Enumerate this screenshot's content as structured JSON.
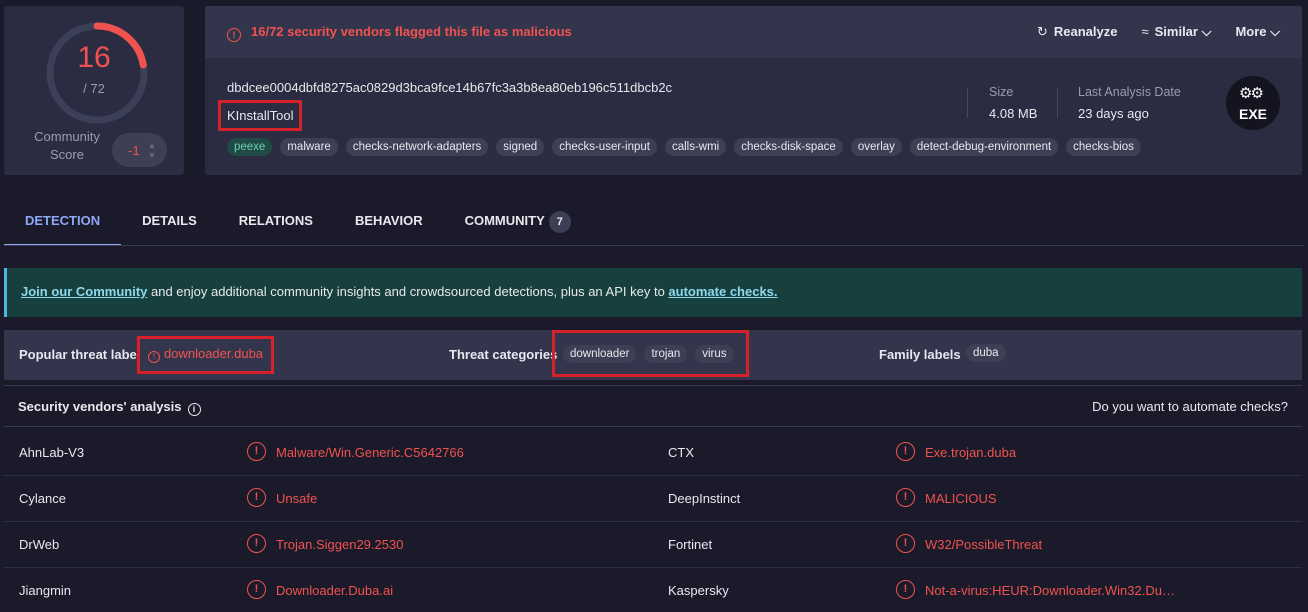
{
  "score": {
    "detections": "16",
    "total": "/ 72",
    "detection_ratio": 0.222,
    "community_label_1": "Community",
    "community_label_2": "Score",
    "community_value": "-1"
  },
  "header": {
    "flag_message": "16/72 security vendors flagged this file as malicious",
    "reanalyze": "Reanalyze",
    "similar": "Similar",
    "more": "More"
  },
  "file": {
    "hash": "dbdcee0004dbfd8275ac0829d3bca9fce14b67fc3a3b8ea80eb196c511dbcb2c",
    "name": "KInstallTool",
    "tags": [
      "peexe",
      "malware",
      "checks-network-adapters",
      "signed",
      "checks-user-input",
      "calls-wmi",
      "checks-disk-space",
      "overlay",
      "detect-debug-environment",
      "checks-bios"
    ],
    "size_label": "Size",
    "size_value": "4.08 MB",
    "date_label": "Last Analysis Date",
    "date_value": "23 days ago",
    "type_badge": "EXE"
  },
  "tabs": [
    {
      "label": "DETECTION"
    },
    {
      "label": "DETAILS"
    },
    {
      "label": "RELATIONS"
    },
    {
      "label": "BEHAVIOR"
    },
    {
      "label": "COMMUNITY",
      "count": "7"
    }
  ],
  "banner": {
    "link1": "Join our Community",
    "text": " and enjoy additional community insights and crowdsourced detections, plus an API key to ",
    "link2": "automate checks."
  },
  "threat": {
    "popular_label": "Popular threat label",
    "popular_value": "downloader.duba",
    "categories_label": "Threat categories",
    "categories": [
      "downloader",
      "trojan",
      "virus"
    ],
    "family_label": "Family labels",
    "family": "duba"
  },
  "vendors": {
    "title": "Security vendors' analysis",
    "automate_prompt": "Do you want to automate checks?",
    "rows": [
      {
        "left_name": "AhnLab-V3",
        "left_result": "Malware/Win.Generic.C5642766",
        "right_name": "CTX",
        "right_result": "Exe.trojan.duba"
      },
      {
        "left_name": "Cylance",
        "left_result": "Unsafe",
        "right_name": "DeepInstinct",
        "right_result": "MALICIOUS"
      },
      {
        "left_name": "DrWeb",
        "left_result": "Trojan.Siggen29.2530",
        "right_name": "Fortinet",
        "right_result": "W32/PossibleThreat"
      },
      {
        "left_name": "Jiangmin",
        "left_result": "Downloader.Duba.ai",
        "right_name": "Kaspersky",
        "right_result": "Not-a-virus:HEUR:Downloader.Win32.Du…"
      }
    ]
  },
  "colors": {
    "accent": "#8ea9f5",
    "malicious": "#f0534f",
    "panel": "#2b2c41",
    "background": "#1b1a2a"
  }
}
